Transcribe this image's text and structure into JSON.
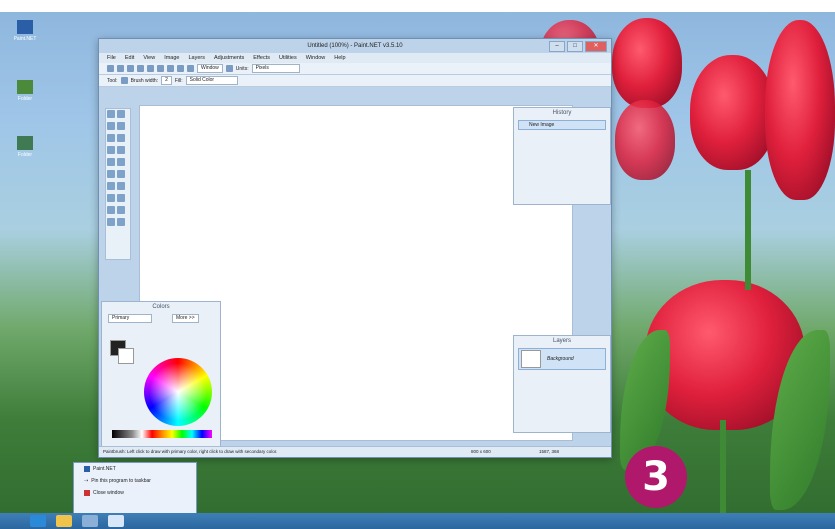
{
  "desktop": {
    "icons": [
      {
        "label": "Paint.NET"
      },
      {
        "label": "Folder"
      },
      {
        "label": "Folder"
      }
    ]
  },
  "window": {
    "title": "Untitled (100%) - Paint.NET v3.5.10",
    "menu": [
      "File",
      "Edit",
      "View",
      "Image",
      "Layers",
      "Adjustments",
      "Effects",
      "Utilities",
      "Window",
      "Help"
    ],
    "toolbar1": {
      "zoom_select": "Window",
      "units_label": "Units:",
      "units_value": "Pixels"
    },
    "toolbar2": {
      "tool_label": "Tool:",
      "brush_label": "Brush width:",
      "brush_value": "2",
      "fill_label": "Fill:",
      "fill_value": "Solid Color"
    },
    "status": {
      "message": "Paintbrush: Left click to draw with primary color, right click to draw with secondary color.",
      "size": "800 x 600",
      "coords": "1587, 368"
    }
  },
  "panels": {
    "history": {
      "title": "History",
      "items": [
        "New Image"
      ]
    },
    "layers": {
      "title": "Layers",
      "items": [
        "Background"
      ]
    },
    "colors": {
      "title": "Colors",
      "mode": "Primary",
      "more_btn": "More >>"
    }
  },
  "jump_list": {
    "items": [
      "Paint.NET",
      "Pin this program to taskbar",
      "Close window"
    ]
  },
  "badge": {
    "number": "3"
  },
  "colors": {
    "accent": "#b0186c",
    "taskbar": "#2c669e"
  }
}
